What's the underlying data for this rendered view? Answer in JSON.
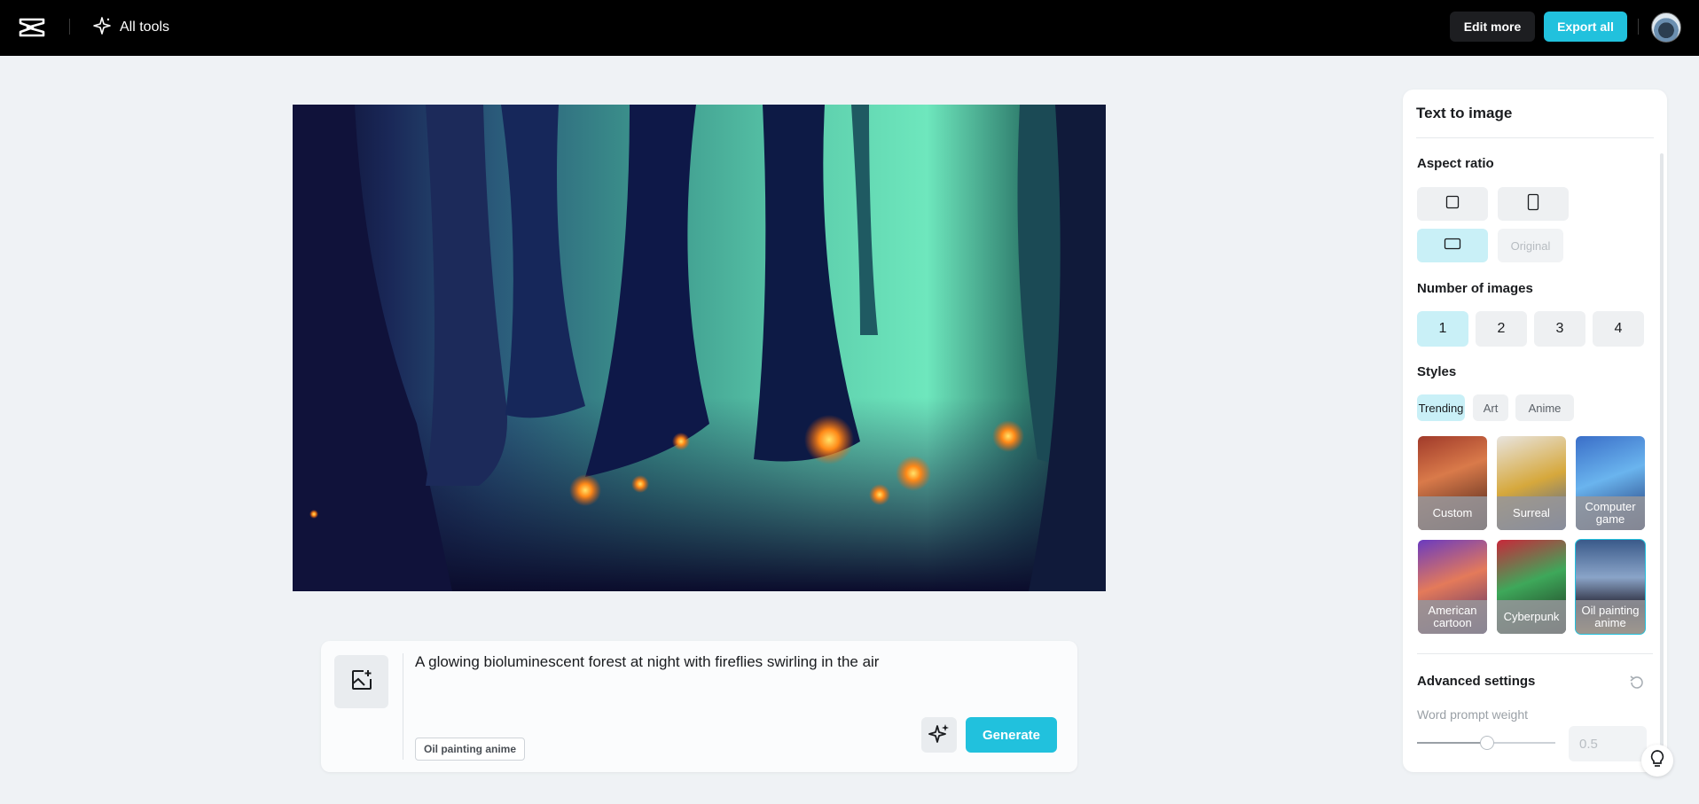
{
  "topbar": {
    "logo_icon": "capcut-logo-icon",
    "all_tools_label": "All tools",
    "edit_more_label": "Edit more",
    "export_all_label": "Export all"
  },
  "prompt": {
    "text": "A glowing bioluminescent forest at night with fireflies swirling in the air",
    "style_tag": "Oil painting anime",
    "generate_label": "Generate"
  },
  "panel": {
    "title": "Text to image",
    "aspect_ratio": {
      "label": "Aspect ratio",
      "options": [
        "square",
        "portrait",
        "landscape"
      ],
      "selected": "landscape",
      "original_label": "Original"
    },
    "number_of_images": {
      "label": "Number of images",
      "options": [
        "1",
        "2",
        "3",
        "4"
      ],
      "selected": "1"
    },
    "styles": {
      "label": "Styles",
      "tabs": [
        "Trending",
        "Art",
        "Anime"
      ],
      "selected_tab": "Trending",
      "cards": [
        {
          "label": "Custom"
        },
        {
          "label": "Surreal"
        },
        {
          "label": "Computer game"
        },
        {
          "label": "American cartoon"
        },
        {
          "label": "Cyberpunk"
        },
        {
          "label": "Oil painting anime"
        }
      ],
      "selected_card": "Oil painting anime"
    },
    "advanced": {
      "label": "Advanced settings",
      "word_prompt_weight_label": "Word prompt weight",
      "word_prompt_weight_value": "0.5",
      "slider_fraction": 0.5
    }
  },
  "colors": {
    "accent": "#21c1dd",
    "selected_bg": "#c9f0f7",
    "topbar": "#000000",
    "canvas": "#eff2f5"
  }
}
